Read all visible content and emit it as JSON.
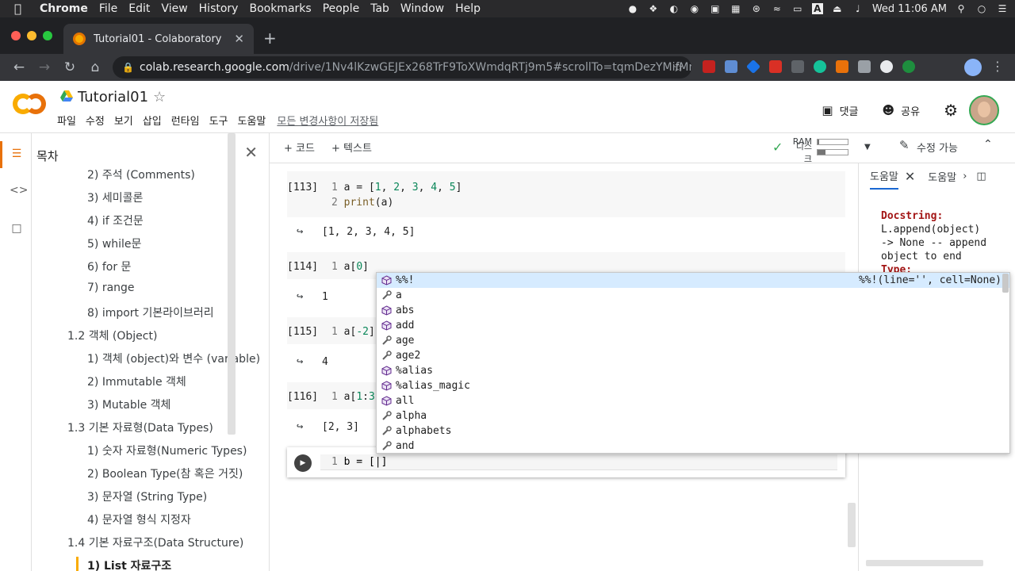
{
  "mac_menubar": {
    "app": "Chrome",
    "items": [
      "File",
      "Edit",
      "View",
      "History",
      "Bookmarks",
      "People",
      "Tab",
      "Window",
      "Help"
    ],
    "clock": "Wed 11:06 AM"
  },
  "browser": {
    "tab_title": "Tutorial01 - Colaboratory",
    "url_host": "colab.research.google.com",
    "url_path": "/drive/1Nv4lKzwGEJEx268TrF9ToXWmdqRTj9m5#scrollTo=tqmDezYMifMm"
  },
  "colab": {
    "doc_title": "Tutorial01",
    "menu": [
      "파일",
      "수정",
      "보기",
      "삽입",
      "런타임",
      "도구",
      "도움말"
    ],
    "saved_status": "모든 변경사항이 저장됨",
    "comment_label": "댓글",
    "share_label": "공유",
    "toolbar": {
      "add_code": "+ 코드",
      "add_text": "+ 텍스트",
      "ram_label": "RAM",
      "disk_label": "디스크",
      "ram_fraction": 0.05,
      "disk_fraction": 0.25,
      "edit_mode": "수정 가능"
    }
  },
  "toc": {
    "title": "목차",
    "items": [
      {
        "label": "2) 주석 (Comments)",
        "level": 3
      },
      {
        "label": "3) 세미콜론",
        "level": 3
      },
      {
        "label": "4) if 조건문",
        "level": 3
      },
      {
        "label": "5) while문",
        "level": 3
      },
      {
        "label": "6) for 문",
        "level": 3
      },
      {
        "label": "7) range",
        "level": 3
      },
      {
        "label": "8) import 기본라이브러리",
        "level": 3
      },
      {
        "label": "1.2 객체 (Object)",
        "level": 2
      },
      {
        "label": "1) 객체 (object)와 변수 (variable)",
        "level": 3
      },
      {
        "label": "2) Immutable 객체",
        "level": 3
      },
      {
        "label": "3) Mutable 객체",
        "level": 3
      },
      {
        "label": "1.3 기본 자료형(Data Types)",
        "level": 2
      },
      {
        "label": "1) 숫자 자료형(Numeric Types)",
        "level": 3
      },
      {
        "label": "2) Boolean Type(참 혹은 거짓)",
        "level": 3
      },
      {
        "label": "3) 문자열 (String Type)",
        "level": 3
      },
      {
        "label": "4) 문자열 형식 지정자",
        "level": 3
      },
      {
        "label": "1.4 기본 자료구조(Data Structure)",
        "level": 2
      },
      {
        "label": "1) List 자료구조",
        "level": 3,
        "active": true
      }
    ]
  },
  "cells": [
    {
      "prompt": "[113]",
      "lines": [
        "1 a = [1, 2, 3, 4, 5]",
        "2 print(a)"
      ],
      "output": "[1, 2, 3, 4, 5]"
    },
    {
      "prompt": "[114]",
      "lines": [
        "1 a[0]"
      ],
      "output": "1"
    },
    {
      "prompt": "[115]",
      "lines": [
        "1 a[-2]"
      ],
      "output": "4"
    },
    {
      "prompt": "[116]",
      "lines": [
        "1 a[1:3"
      ],
      "output": "[2, 3]"
    }
  ],
  "active_cell": {
    "code": "1 b = []"
  },
  "help_panel": {
    "tab1": "도움말",
    "tab2": "도움말",
    "doc_heading": "Docstring:",
    "doc_body": "L.append(object)\n-> None -- append\nobject to end",
    "doc_type": "Type:"
  },
  "autocomplete": {
    "items": [
      {
        "label": "%%!",
        "kind": "cube",
        "signature": "%%!(line='', cell=None)",
        "selected": true
      },
      {
        "label": "a",
        "kind": "wrench"
      },
      {
        "label": "abs",
        "kind": "cube"
      },
      {
        "label": "add",
        "kind": "cube"
      },
      {
        "label": "age",
        "kind": "wrench"
      },
      {
        "label": "age2",
        "kind": "wrench"
      },
      {
        "label": "%alias",
        "kind": "cube"
      },
      {
        "label": "%alias_magic",
        "kind": "cube"
      },
      {
        "label": "all",
        "kind": "cube"
      },
      {
        "label": "alpha",
        "kind": "wrench"
      },
      {
        "label": "alphabets",
        "kind": "wrench"
      },
      {
        "label": "and",
        "kind": "wrench"
      }
    ]
  }
}
